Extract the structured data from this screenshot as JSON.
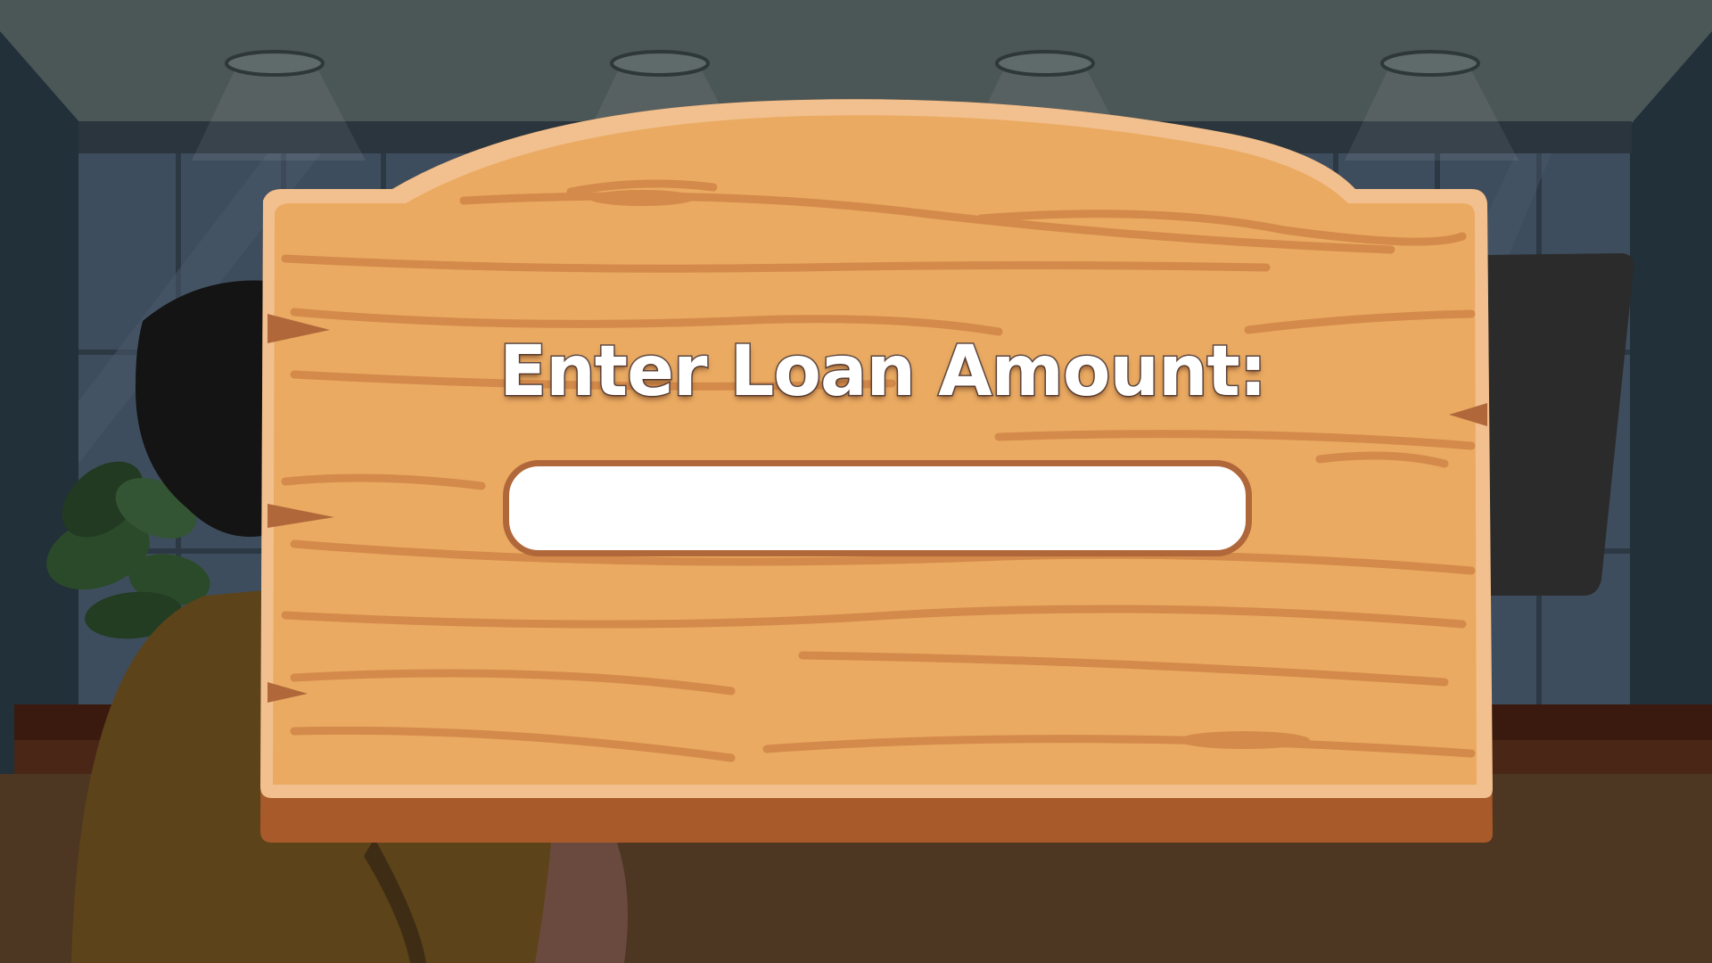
{
  "sign": {
    "title": "Enter Loan Amount:"
  },
  "loan_input": {
    "value": "",
    "placeholder": ""
  },
  "colors": {
    "wood_light": "#eaaa62",
    "wood_grain": "#d48a4a",
    "wood_edge": "#a85a2a",
    "input_border": "#b0683a",
    "ceiling": "#4b5657",
    "wall": "#22303a",
    "window": "#3d4c5c",
    "desk": "#472315",
    "floor": "#4c3522",
    "character_shirt": "#5d431a",
    "character_hair": "#141414"
  }
}
